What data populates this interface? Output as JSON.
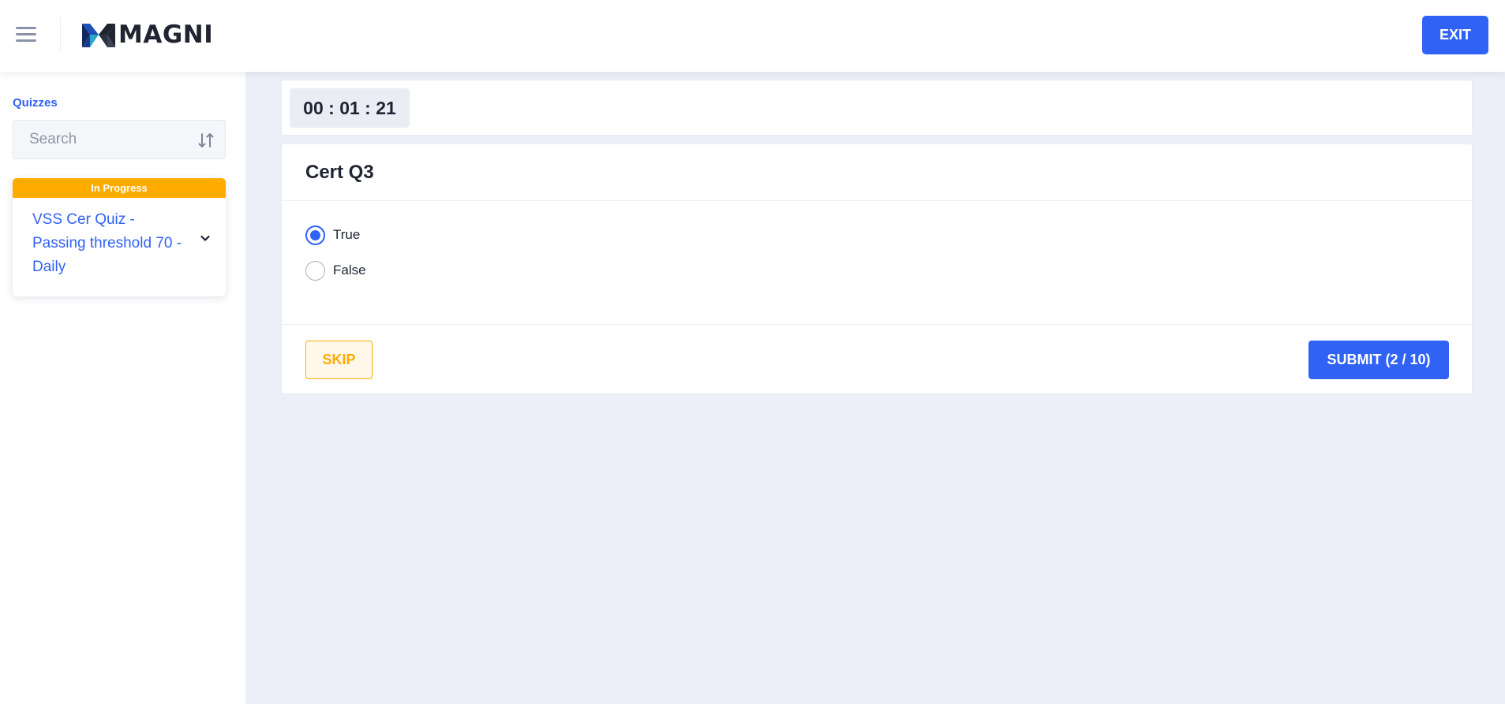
{
  "header": {
    "brand": "MAGNI",
    "exit_label": "EXIT"
  },
  "sidebar": {
    "title": "Quizzes",
    "search_placeholder": "Search",
    "quizzes": [
      {
        "status": "In Progress",
        "title": "VSS Cer Quiz - Passing threshold 70 - Daily"
      }
    ]
  },
  "main": {
    "timer": "00 : 01 : 21",
    "question": {
      "title": "Cert Q3",
      "options": [
        {
          "label": "True",
          "selected": true
        },
        {
          "label": "False",
          "selected": false
        }
      ]
    },
    "skip_label": "SKIP",
    "submit_label": "SUBMIT (2 / 10)"
  },
  "icons": {
    "menu": "hamburger-menu-icon",
    "sort": "sort-icon",
    "chevron": "chevron-down-icon",
    "logo": "magni-logo"
  },
  "colors": {
    "primary": "#3062f5",
    "warning": "#ffab00",
    "background": "#eceff7",
    "text": "#1e2433"
  }
}
